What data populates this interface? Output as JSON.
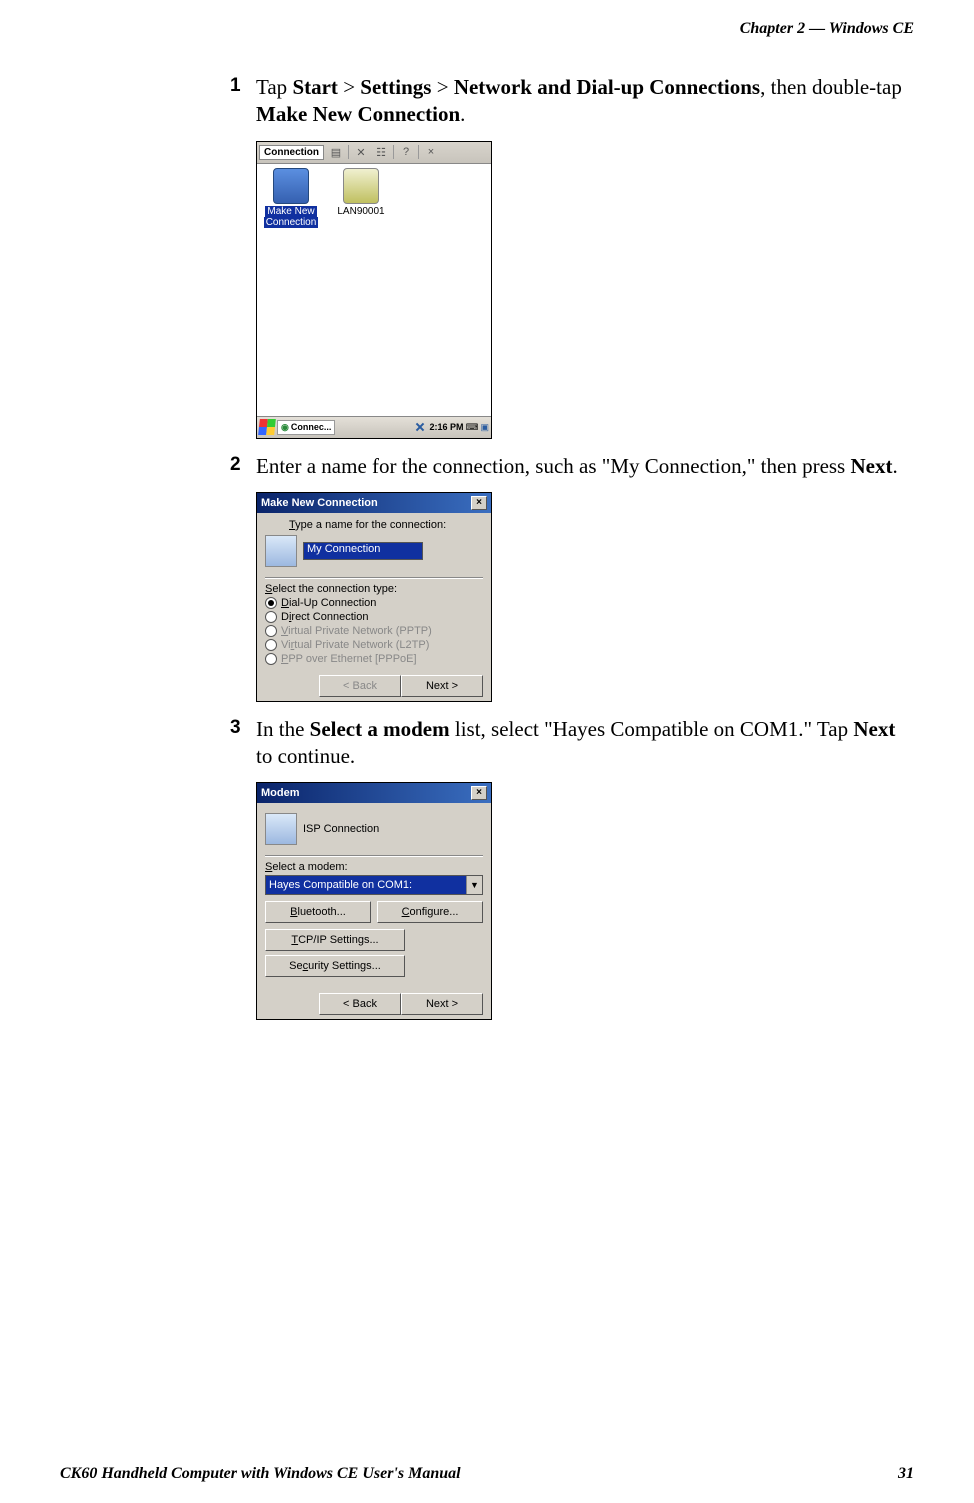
{
  "header": {
    "chapter": "Chapter 2 —  Windows CE"
  },
  "footer": {
    "manual": "CK60 Handheld Computer with Windows CE User's Manual",
    "page": "31"
  },
  "steps": {
    "s1": {
      "num": "1",
      "pre": "Tap ",
      "b1": "Start",
      "sep1": " > ",
      "b2": "Settings",
      "sep2": " > ",
      "b3": "Network and Dial-up Connections",
      "mid": ", then double-tap ",
      "b4": "Make New Connection",
      "end": "."
    },
    "s2": {
      "num": "2",
      "pre": "Enter a name for the connection, such as \"My Connection,\" then press ",
      "b1": "Next",
      "end": "."
    },
    "s3": {
      "num": "3",
      "pre": "In the ",
      "b1": "Select a modem",
      "mid": " list, select \"Hayes Compatible on COM1.\" Tap ",
      "b2": "Next",
      "end": " to continue."
    }
  },
  "ss1": {
    "title": "Connection",
    "icon1_label1": "Make New",
    "icon1_label2": "Connection",
    "icon2_label": "LAN90001",
    "task_label": "Connec...",
    "clock": "2:16 PM"
  },
  "ss2": {
    "title": "Make New Connection",
    "type_prefix": "T",
    "type_rest": "ype a name for the connection:",
    "name_value": "My Connection",
    "select_prefix": "S",
    "select_rest": "elect the connection type:",
    "r1_prefix": "D",
    "r1_rest": "ial-Up Connection",
    "r2_pre": "D",
    "r2_mid": "i",
    "r2_rest": "rect Connection",
    "r3_pre": "V",
    "r3_rest": "irtual Private Network (PPTP)",
    "r4_pre": "Vi",
    "r4_mid": "r",
    "r4_rest": "tual Private Network (L2TP)",
    "r5_pre": "P",
    "r5_rest": "PP over Ethernet [PPPoE]",
    "back": "< Back",
    "next": "Next >"
  },
  "ss3": {
    "title": "Modem",
    "conn_label": "ISP Connection",
    "select_prefix": "S",
    "select_rest": "elect a modem:",
    "dropdown": "Hayes Compatible on COM1:",
    "bluetooth_pre": "B",
    "bluetooth_rest": "luetooth...",
    "configure_pre": "C",
    "configure_rest": "onfigure...",
    "tcpip_pre": "T",
    "tcpip_rest": "CP/IP Settings...",
    "security_pre": "Se",
    "security_mid": "c",
    "security_rest": "urity Settings...",
    "back": "< Back",
    "next": "Next >"
  }
}
